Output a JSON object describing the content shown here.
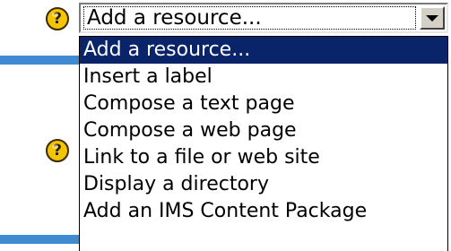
{
  "select": {
    "value": "Add a resource...",
    "options": [
      "Add a resource...",
      "Insert a label",
      "Compose a text page",
      "Compose a web page",
      "Link to a file or web site",
      "Display a directory",
      "Add an IMS Content Package"
    ],
    "selected_index": 0
  },
  "help_icon_glyph": "?",
  "colors": {
    "highlight": "#0a246a",
    "bar": "#3f8ad1",
    "help_icon": "#f5c400"
  }
}
